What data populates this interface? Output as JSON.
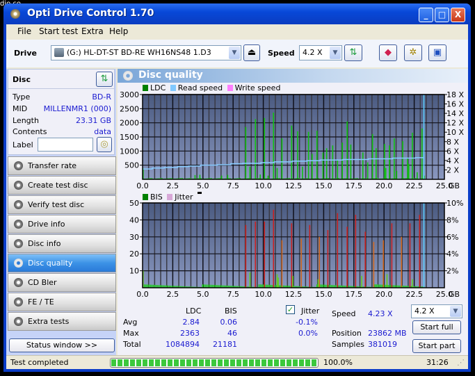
{
  "desktop": {
    "fragment": "dio co..."
  },
  "window": {
    "title": "Opti Drive Control 1.70",
    "buttons": {
      "minimize": "_",
      "maximize": "□",
      "close": "X"
    }
  },
  "menu": {
    "items": [
      "File",
      "Start test",
      "Extra",
      "Help"
    ]
  },
  "toolbar": {
    "drive_label": "Drive",
    "drive_value": "(G:)  HL-DT-ST BD-RE  WH16NS48 1.D3",
    "speed_label": "Speed",
    "speed_value": "4.2 X"
  },
  "disc": {
    "title": "Disc",
    "rows": [
      {
        "label": "Type",
        "value": "BD-R"
      },
      {
        "label": "MID",
        "value": "MILLENMR1 (000)"
      },
      {
        "label": "Length",
        "value": "23.31 GB"
      },
      {
        "label": "Contents",
        "value": "data"
      }
    ],
    "label_field_label": "Label",
    "label_value": ""
  },
  "nav": {
    "items": [
      "Transfer rate",
      "Create test disc",
      "Verify test disc",
      "Drive info",
      "Disc info",
      "Disc quality",
      "CD Bler",
      "FE / TE",
      "Extra tests"
    ],
    "active": "Disc quality"
  },
  "status_window_button": "Status window >>",
  "panel": {
    "title": "Disc quality"
  },
  "chart_data": [
    {
      "type": "bar",
      "title": "LDC / Read speed",
      "legend": [
        "LDC",
        "Read speed",
        "Write speed"
      ],
      "legend_colors": [
        "#008000",
        "#80c8ff",
        "#ff80ff"
      ],
      "x_unit": "GB",
      "xlim": [
        0,
        25
      ],
      "x_ticks": [
        "0.0",
        "2.5",
        "5.0",
        "7.5",
        "10.0",
        "12.5",
        "15.0",
        "17.5",
        "20.0",
        "22.5",
        "25.0"
      ],
      "ylim": [
        0,
        3000
      ],
      "y_ticks": [
        "500",
        "1000",
        "1500",
        "2000",
        "2500",
        "3000"
      ],
      "y2lim": [
        0,
        18
      ],
      "y2_ticks": [
        "2 X",
        "4 X",
        "6 X",
        "8 X",
        "10 X",
        "12 X",
        "14 X",
        "16 X",
        "18 X"
      ],
      "ldc_spikes": [
        [
          0.0,
          400
        ],
        [
          4.3,
          150
        ],
        [
          4.7,
          160
        ],
        [
          6.5,
          130
        ],
        [
          7.0,
          160
        ],
        [
          8.5,
          1850
        ],
        [
          8.85,
          450
        ],
        [
          9.3,
          2130
        ],
        [
          9.7,
          170
        ],
        [
          10.05,
          2170
        ],
        [
          10.35,
          130
        ],
        [
          10.8,
          2360
        ],
        [
          11.1,
          400
        ],
        [
          11.5,
          1450
        ],
        [
          12.3,
          1900
        ],
        [
          12.8,
          1700
        ],
        [
          13.2,
          450
        ],
        [
          13.7,
          1680
        ],
        [
          14.0,
          900
        ],
        [
          14.4,
          1720
        ],
        [
          14.9,
          950
        ],
        [
          15.2,
          1100
        ],
        [
          15.7,
          1200
        ],
        [
          16.1,
          700
        ],
        [
          16.5,
          1300
        ],
        [
          16.9,
          2050
        ],
        [
          17.2,
          1230
        ],
        [
          18.2,
          950
        ],
        [
          18.6,
          600
        ],
        [
          19.0,
          1600
        ],
        [
          19.3,
          1100
        ],
        [
          20.0,
          1250
        ],
        [
          20.1,
          400
        ],
        [
          20.4,
          1200
        ],
        [
          20.8,
          1450
        ],
        [
          21.0,
          300
        ],
        [
          21.5,
          1350
        ],
        [
          21.9,
          750
        ],
        [
          22.0,
          550
        ],
        [
          22.3,
          1650
        ],
        [
          22.7,
          250
        ],
        [
          23.1,
          1800
        ],
        [
          23.3,
          130
        ]
      ],
      "read_speed": [
        [
          0,
          2.2
        ],
        [
          0.8,
          2.4
        ],
        [
          1.8,
          2.5
        ],
        [
          2.9,
          2.7
        ],
        [
          3.8,
          2.8
        ],
        [
          4.8,
          3.0
        ],
        [
          6.2,
          3.1
        ],
        [
          7.3,
          3.3
        ],
        [
          8.3,
          3.4
        ],
        [
          9.8,
          3.55
        ],
        [
          10.9,
          3.7
        ],
        [
          12.4,
          3.85
        ],
        [
          13.6,
          3.95
        ],
        [
          14.7,
          4.1
        ],
        [
          16.6,
          4.2
        ],
        [
          18.7,
          4.35
        ],
        [
          20.7,
          4.5
        ],
        [
          22.6,
          4.6
        ],
        [
          23.3,
          4.6
        ]
      ],
      "end_marker_gb": 23.3
    },
    {
      "type": "bar",
      "title": "BIS / Jitter",
      "legend": [
        "BIS",
        "Jitter"
      ],
      "legend_colors": [
        "#008000",
        "#d8a8d8"
      ],
      "x_unit": "GB",
      "xlim": [
        0,
        25
      ],
      "x_ticks": [
        "0.0",
        "2.5",
        "5.0",
        "7.5",
        "10.0",
        "12.5",
        "15.0",
        "17.5",
        "20.0",
        "22.5",
        "25.0"
      ],
      "ylim": [
        0,
        50
      ],
      "y_ticks": [
        "10",
        "20",
        "30",
        "40",
        "50"
      ],
      "y2lim": [
        0,
        10
      ],
      "y2_ticks": [
        "2%",
        "4%",
        "6%",
        "8%",
        "10%"
      ],
      "bis_spikes": [
        [
          8.5,
          37,
          "red"
        ],
        [
          9.3,
          39,
          "red"
        ],
        [
          10.05,
          39,
          "red"
        ],
        [
          10.8,
          46,
          "red"
        ],
        [
          11.5,
          28,
          "orange"
        ],
        [
          12.3,
          38,
          "red"
        ],
        [
          13.1,
          29,
          "orange"
        ],
        [
          13.8,
          37,
          "red"
        ],
        [
          14.6,
          30,
          "orange"
        ],
        [
          15.3,
          34,
          "red"
        ],
        [
          16.1,
          44,
          "red"
        ],
        [
          16.9,
          36,
          "red"
        ],
        [
          17.6,
          43,
          "red"
        ],
        [
          18.4,
          33,
          "red"
        ],
        [
          19.1,
          27,
          "orange"
        ],
        [
          19.9,
          28,
          "orange"
        ],
        [
          20.6,
          38,
          "red"
        ],
        [
          21.4,
          30,
          "orange"
        ],
        [
          22.1,
          38,
          "red"
        ],
        [
          22.9,
          43,
          "red"
        ]
      ],
      "end_marker_gb": 23.3
    }
  ],
  "stats": {
    "headers": [
      "LDC",
      "BIS"
    ],
    "rows": [
      {
        "label": "Avg",
        "ldc": "2.84",
        "bis": "0.06",
        "jitter": "-0.1%"
      },
      {
        "label": "Max",
        "ldc": "2363",
        "bis": "46",
        "jitter": "0.0%"
      },
      {
        "label": "Total",
        "ldc": "1084894",
        "bis": "21181"
      }
    ],
    "jitter_label": "Jitter",
    "jitter_checked": true,
    "speed_label": "Speed",
    "speed_value": "4.23 X",
    "speed_select": "4.2 X",
    "position_label": "Position",
    "position_value": "23862 MB",
    "samples_label": "Samples",
    "samples_value": "381019",
    "start_full": "Start full",
    "start_part": "Start part"
  },
  "statusbar": {
    "message": "Test completed",
    "progress_percent": 100,
    "progress_text": "100.0%",
    "elapsed": "31:26"
  }
}
